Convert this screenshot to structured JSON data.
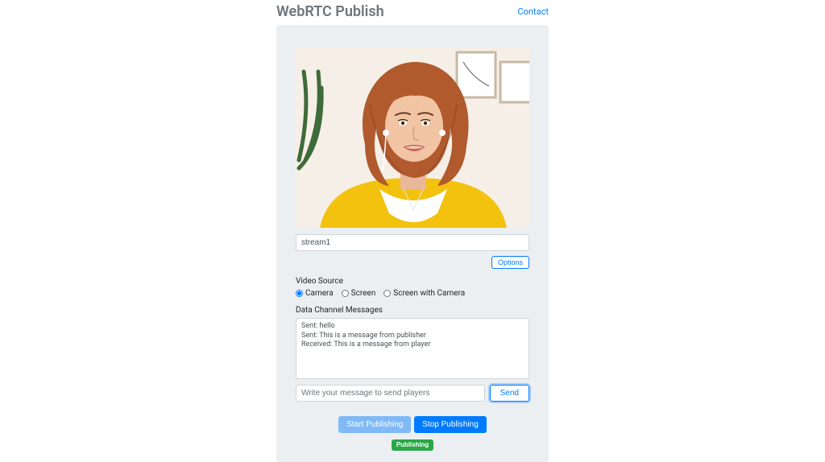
{
  "header": {
    "title": "WebRTC Publish",
    "contact": "Contact"
  },
  "stream": {
    "value": "stream1"
  },
  "options_btn": "Options",
  "video_source": {
    "label": "Video Source",
    "options": [
      "Camera",
      "Screen",
      "Screen with Camera"
    ],
    "selected": "Camera"
  },
  "data_channel": {
    "label": "Data Channel Messages",
    "messages": "Sent: hello\nSent: This is a message from publisher\nReceived: This is a message from player",
    "placeholder": "Write your message to send players",
    "send": "Send"
  },
  "actions": {
    "start": "Start Publishing",
    "stop": "Stop Publishing"
  },
  "status": "Publishing"
}
